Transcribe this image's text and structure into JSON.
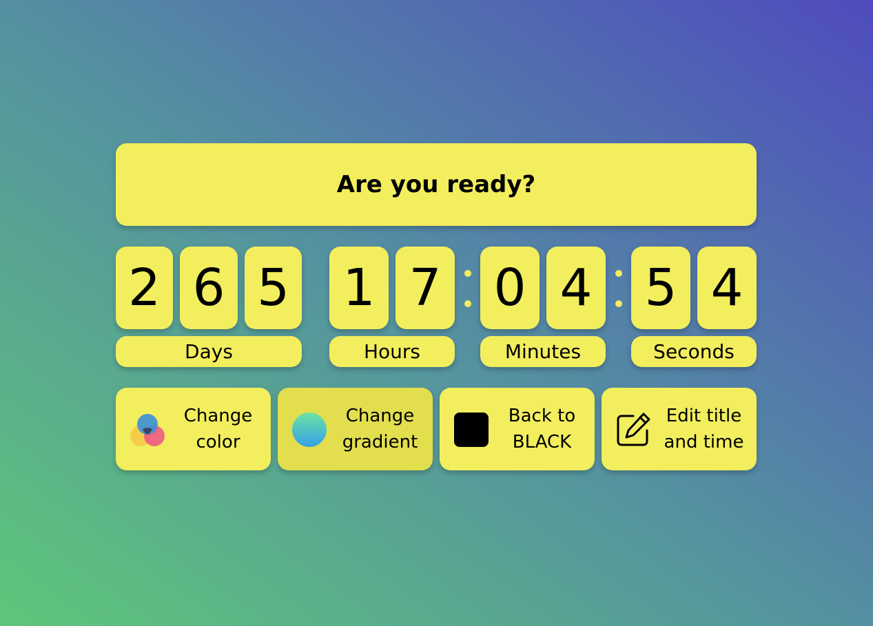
{
  "title": "Are you ready?",
  "countdown": {
    "days": [
      "2",
      "6",
      "5"
    ],
    "hours": [
      "1",
      "7"
    ],
    "minutes": [
      "0",
      "4"
    ],
    "seconds": [
      "5",
      "4"
    ]
  },
  "units": {
    "days": "Days",
    "hours": "Hours",
    "minutes": "Minutes",
    "seconds": "Seconds"
  },
  "actions": [
    {
      "line1": "Change",
      "line2": "color",
      "icon": "color-circles-icon"
    },
    {
      "line1": "Change",
      "line2": "gradient",
      "icon": "gradient-circle-icon",
      "active": true
    },
    {
      "line1": "Back to",
      "line2": "BLACK",
      "icon": "black-square-icon"
    },
    {
      "line1": "Edit title",
      "line2": "and time",
      "icon": "edit-icon"
    }
  ],
  "colors": {
    "card": "#f2ee5e",
    "card_active": "#e2de4e",
    "background_start": "#5ec67a",
    "background_end": "#4f4bbe",
    "text": "#000000"
  }
}
